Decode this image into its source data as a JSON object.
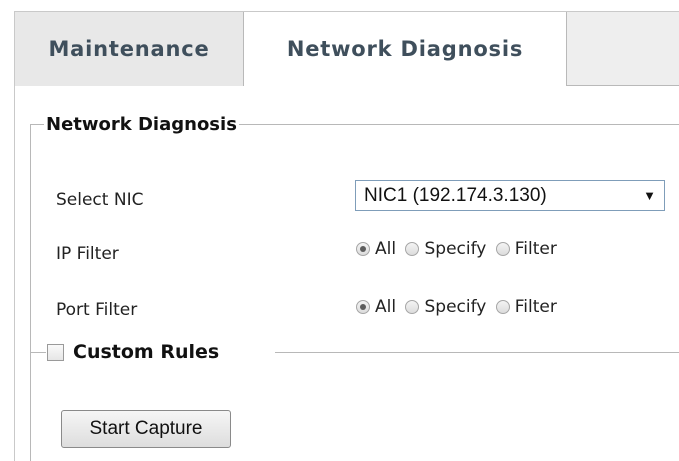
{
  "tabs": [
    {
      "label": "Maintenance",
      "active": false
    },
    {
      "label": "Network Diagnosis",
      "active": true
    }
  ],
  "section": {
    "title": "Network Diagnosis"
  },
  "select_nic": {
    "label": "Select NIC",
    "value": "NIC1 (192.174.3.130)",
    "arrow_icon": "triangle-down"
  },
  "ip_filter": {
    "label": "IP Filter",
    "options": [
      "All",
      "Specify",
      "Filter"
    ],
    "selected": "All"
  },
  "port_filter": {
    "label": "Port Filter",
    "options": [
      "All",
      "Specify",
      "Filter"
    ],
    "selected": "All"
  },
  "custom_rules": {
    "label": "Custom Rules",
    "checked": false
  },
  "actions": {
    "start_capture_label": "Start Capture"
  },
  "colors": {
    "tab_text": "#3f4f5c",
    "tab_bg": "#eeeeee",
    "active_tab_bg": "#ffffff",
    "border": "#b8b8b8",
    "select_border": "#7f9db9"
  }
}
